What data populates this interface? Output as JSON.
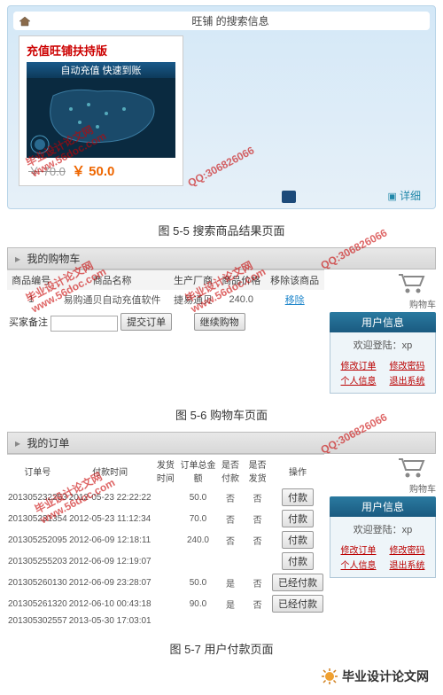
{
  "panel1": {
    "searchbar_title": "旺铺 的搜索信息",
    "product_title": "充值旺铺扶持版",
    "map_banner": "自动充值 快速到账",
    "old_price": "￥ 70.0",
    "new_price": "￥ 50.0",
    "detail_link": "详细"
  },
  "captions": {
    "c1": "图 5-5 搜索商品结果页面",
    "c2": "图 5-6 购物车页面",
    "c3": "图 5-7 用户付款页面"
  },
  "cart": {
    "tab_title": "我的购物车",
    "side_title": "购物车",
    "headers": [
      "商品编号",
      "商品名称",
      "生产厂商",
      "商品价格",
      "移除该商品"
    ],
    "row": [
      "1",
      "易购通贝自动充值软件",
      "捷易通贝",
      "240.0",
      "移除"
    ],
    "buyer_label": "买家备注",
    "submit_btn": "提交订单",
    "continue_btn": "继续购物"
  },
  "userinfo": {
    "title": "用户信息",
    "welcome": "欢迎登陆：xp",
    "links": [
      "修改订单",
      "修改密码",
      "个人信息",
      "退出系统"
    ]
  },
  "orders": {
    "tab_title": "我的订单",
    "side_title": "购物车",
    "headers": [
      "订单号",
      "付款时间",
      "发货时间",
      "订单总金额",
      "是否付款",
      "是否发货",
      "操作"
    ],
    "rows": [
      [
        "201305232253",
        "2012-05-23 22:22:22",
        "",
        "50.0",
        "否",
        "否",
        "付款"
      ],
      [
        "201305231354",
        "2012-05-23 11:12:34",
        "",
        "70.0",
        "否",
        "否",
        "付款"
      ],
      [
        "201305252095",
        "2012-06-09 12:18:11",
        "",
        "240.0",
        "否",
        "否",
        "付款"
      ],
      [
        "201305255203",
        "2012-06-09 12:19:07",
        "",
        "",
        "",
        "",
        "付款"
      ],
      [
        "201305260130",
        "2012-06-09 23:28:07",
        "",
        "50.0",
        "是",
        "否",
        "已经付款"
      ],
      [
        "201305261320",
        "2012-06-10 00:43:18",
        "",
        "90.0",
        "是",
        "否",
        "已经付款"
      ],
      [
        "201305302557",
        "2013-05-30 17:03:01",
        "",
        "",
        "",
        "",
        ""
      ]
    ]
  },
  "watermark": {
    "site": "www.56doc.com",
    "brand": "毕业设计论文网",
    "qq": "QQ:306826066"
  },
  "footer": {
    "text": "毕业设计论文网"
  }
}
